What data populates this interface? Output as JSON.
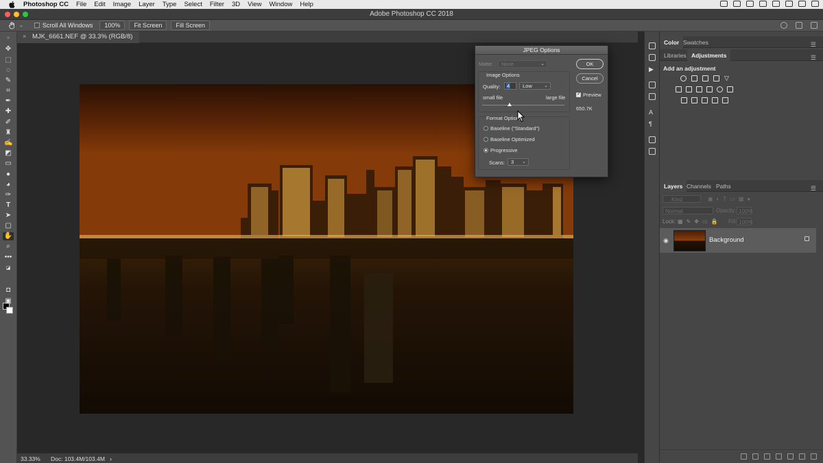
{
  "menubar": {
    "app_name": "Photoshop CC",
    "items": [
      "File",
      "Edit",
      "Image",
      "Layer",
      "Type",
      "Select",
      "Filter",
      "3D",
      "View",
      "Window",
      "Help"
    ]
  },
  "window": {
    "title": "Adobe Photoshop CC 2018"
  },
  "options_bar": {
    "scroll_all_label": "Scroll All Windows",
    "zoom_btn": "100%",
    "fit_screen_btn": "Fit Screen",
    "fill_screen_btn": "Fill Screen"
  },
  "document": {
    "tab_title": "MJK_6661.NEF @ 33.3% (RGB/8)"
  },
  "status": {
    "zoom": "33.33%",
    "doc_size": "Doc: 103.4M/103.4M",
    "arrow": "›"
  },
  "panels": {
    "color_tabs": [
      "Color",
      "Swatches"
    ],
    "adj_tabs": [
      "Libraries",
      "Adjustments"
    ],
    "add_adjustment": "Add an adjustment",
    "layers_tabs": [
      "Layers",
      "Channels",
      "Paths"
    ],
    "kind_placeholder": "Kind",
    "blend_mode": "Normal",
    "opacity_label": "Opacity:",
    "opacity_value": "100%",
    "lock_label": "Lock:",
    "fill_label": "Fill:",
    "fill_value": "100%",
    "layer_name": "Background"
  },
  "dialog": {
    "title": "JPEG Options",
    "matte_label": "Matte:",
    "matte_value": "None",
    "image_options_label": "Image Options",
    "quality_label": "Quality:",
    "quality_value": "4",
    "quality_preset": "Low",
    "quality_level": 0.33,
    "small_file_label": "small file",
    "large_file_label": "large file",
    "format_options_label": "Format Options",
    "format_baseline_standard": "Baseline (\"Standard\")",
    "format_baseline_optimized": "Baseline Optimized",
    "format_progressive": "Progressive",
    "scans_label": "Scans:",
    "scans_value": "3",
    "ok_label": "OK",
    "cancel_label": "Cancel",
    "preview_label": "Preview",
    "preview_checked": true,
    "file_size": "650.7K"
  }
}
